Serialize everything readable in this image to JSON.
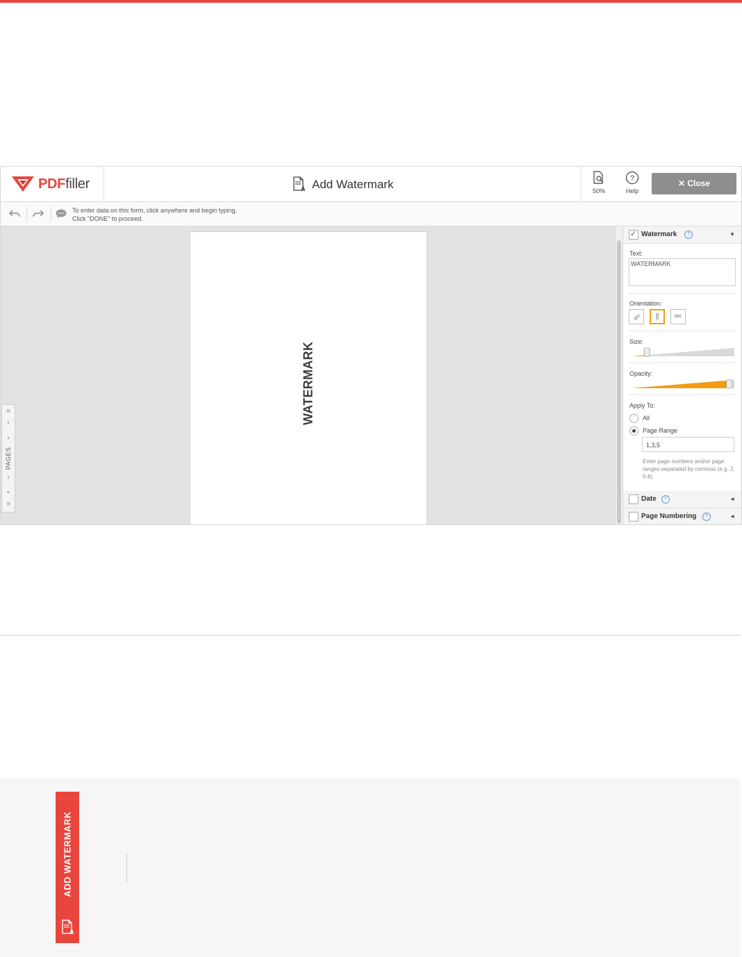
{
  "header": {
    "logo_pdf": "PDF",
    "logo_filler": "filler",
    "title": "Add Watermark",
    "zoom_label": "50%",
    "help_label": "Help",
    "close_label": "Close"
  },
  "toolbar": {
    "hint_line1": "To enter data on this form, click anywhere and begin typing.",
    "hint_line2": "Click \"DONE\" to proceed."
  },
  "document": {
    "watermark_text": "WATERMARK"
  },
  "pages_tab": {
    "label": "PAGES"
  },
  "panel": {
    "watermark": {
      "title": "Watermark",
      "checked": true,
      "text_label": "Text:",
      "text_value": "WATERMARK",
      "orientation_label": "Orientation:",
      "orientation_options": [
        "diagonal",
        "vertical",
        "horizontal"
      ],
      "orientation_selected": "vertical",
      "horizontal_sample": "abc",
      "size_label": "Size:",
      "size_value": 0.15,
      "opacity_label": "Opacity:",
      "opacity_value": 0.95,
      "apply_to_label": "Apply To:",
      "option_all": "All",
      "option_page_range": "Page Range",
      "selected_option": "Page Range",
      "page_range_value": "1,3,5",
      "page_range_note": "Enter page numbers and/or page ranges separated by commas (e.g. 2, 5-8)"
    },
    "date": {
      "title": "Date",
      "checked": false
    },
    "page_numbering": {
      "title": "Page Numbering",
      "checked": false
    }
  },
  "side_banner": {
    "label": "ADD WATERMARK"
  },
  "colors": {
    "brand_red": "#e8453c",
    "accent_orange": "#f39c12",
    "close_button": "#8e8e8e"
  }
}
